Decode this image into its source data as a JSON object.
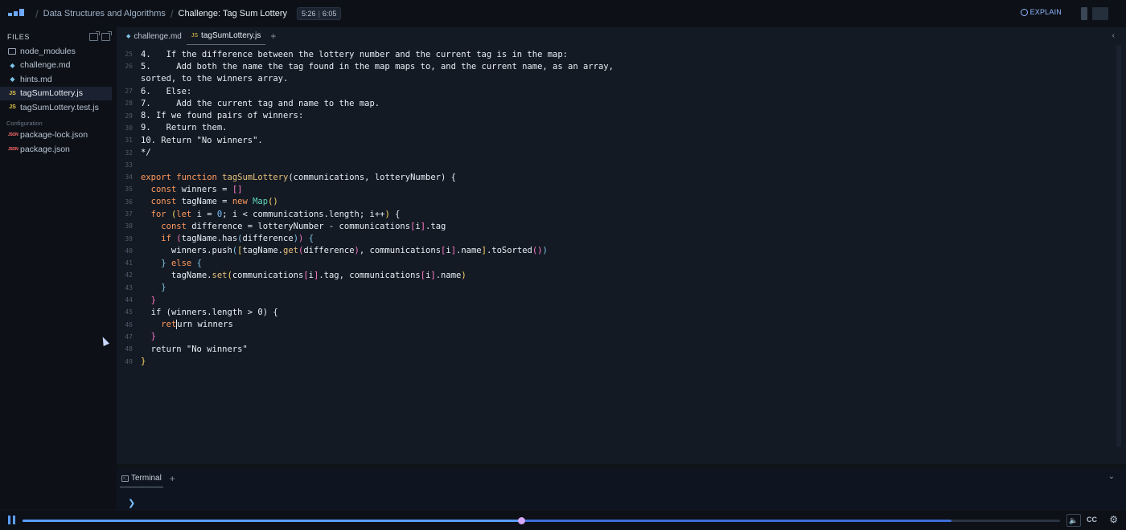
{
  "topbar": {
    "breadcrumb_course": "Data Structures and Algorithms",
    "breadcrumb_challenge": "Challenge: Tag Sum Lottery",
    "time_current": "5:26",
    "time_total": "6:05",
    "explain_label": "EXPLAIN"
  },
  "sidebar": {
    "title": "FILES",
    "files": [
      {
        "name": "node_modules",
        "icon": "folder-icon"
      },
      {
        "name": "challenge.md",
        "icon": "markdown-icon"
      },
      {
        "name": "hints.md",
        "icon": "markdown-icon"
      },
      {
        "name": "tagSumLottery.js",
        "icon": "js-icon",
        "active": true
      },
      {
        "name": "tagSumLottery.test.js",
        "icon": "js-icon"
      }
    ],
    "config_label": "Configuration",
    "config_files": [
      {
        "name": "package-lock.json",
        "icon": "json-icon"
      },
      {
        "name": "package.json",
        "icon": "json-icon"
      }
    ]
  },
  "editor": {
    "tabs": [
      {
        "label": "challenge.md"
      },
      {
        "label": "tagSumLottery.js",
        "active": true
      }
    ],
    "line_numbers": [
      "25",
      "26",
      "",
      "27",
      "28",
      "29",
      "30",
      "31",
      "32",
      "33",
      "34",
      "35",
      "36",
      "37",
      "38",
      "39",
      "40",
      "41",
      "42",
      "43",
      "44",
      "45",
      "46",
      "47",
      "48",
      "49"
    ],
    "code": {
      "l25": "4.   If the difference between the lottery number and the current tag is in the map:",
      "l26": "5.     Add both the name the tag found in the map maps to, and the current name, as an array,",
      "l26b": "sorted, to the winners array.",
      "l27": "6.   Else:",
      "l28": "7.     Add the current tag and name to the map.",
      "l29": "8. If we found pairs of winners:",
      "l30": "9.   Return them.",
      "l31": "10. Return \"No winners\".",
      "l32": "*/",
      "l34_export": "export",
      "l34_function": "function",
      "l34_name": "tagSumLottery",
      "l34_params": "(communications, lotteryNumber) {",
      "l45": "if (winners.length > 0) {",
      "l46_ret1": "ret",
      "l46_ret2": "urn winners",
      "l48": "return \"No winners\""
    }
  },
  "terminal": {
    "tab_label": "Terminal",
    "prompt": "❯"
  },
  "player": {
    "progress_fraction": 0.481,
    "buffered_fraction": 0.895,
    "cc_label": "CC"
  }
}
